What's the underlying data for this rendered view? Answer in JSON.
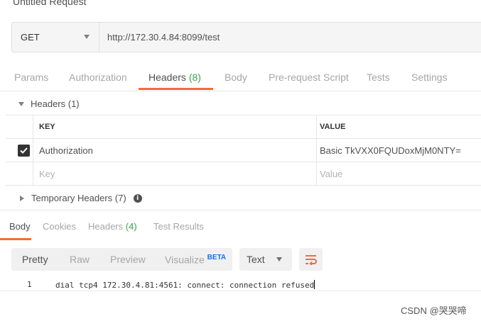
{
  "window": {
    "title": "Untitled Request"
  },
  "request": {
    "method": "GET",
    "url": "http://172.30.4.84:8099/test"
  },
  "request_tabs": [
    {
      "label": "Params"
    },
    {
      "label": "Authorization"
    },
    {
      "label": "Headers",
      "count": "(8)",
      "active": true
    },
    {
      "label": "Body"
    },
    {
      "label": "Pre-request Script"
    },
    {
      "label": "Tests"
    },
    {
      "label": "Settings"
    }
  ],
  "headers_section": {
    "title": "Headers (1)",
    "columns": {
      "key": "KEY",
      "value": "VALUE"
    },
    "rows": [
      {
        "checked": true,
        "key": "Authorization",
        "value": "Basic TkVXX0FQUDoxMjM0NTY="
      }
    ],
    "placeholder": {
      "key": "Key",
      "value": "Value"
    }
  },
  "temporary_headers": {
    "title": "Temporary Headers (7)",
    "info_icon": "info-icon"
  },
  "response_tabs": [
    {
      "label": "Body",
      "active": true
    },
    {
      "label": "Cookies"
    },
    {
      "label": "Headers",
      "count": "(4)"
    },
    {
      "label": "Test Results"
    }
  ],
  "view_modes": [
    {
      "label": "Pretty",
      "active": true
    },
    {
      "label": "Raw"
    },
    {
      "label": "Preview"
    },
    {
      "label": "Visualize",
      "badge": "BETA"
    }
  ],
  "format": {
    "selected": "Text"
  },
  "wrap_icon": "wrap-lines-icon",
  "response_body": {
    "lines": [
      {
        "number": "1",
        "text": "dial tcp4 172.30.4.81:4561: connect: connection refused"
      }
    ]
  },
  "watermark": "CSDN @哭哭啼",
  "colors": {
    "accent": "#f26b3a",
    "count_green": "#3ca34a",
    "beta_blue": "#1a73e8"
  }
}
